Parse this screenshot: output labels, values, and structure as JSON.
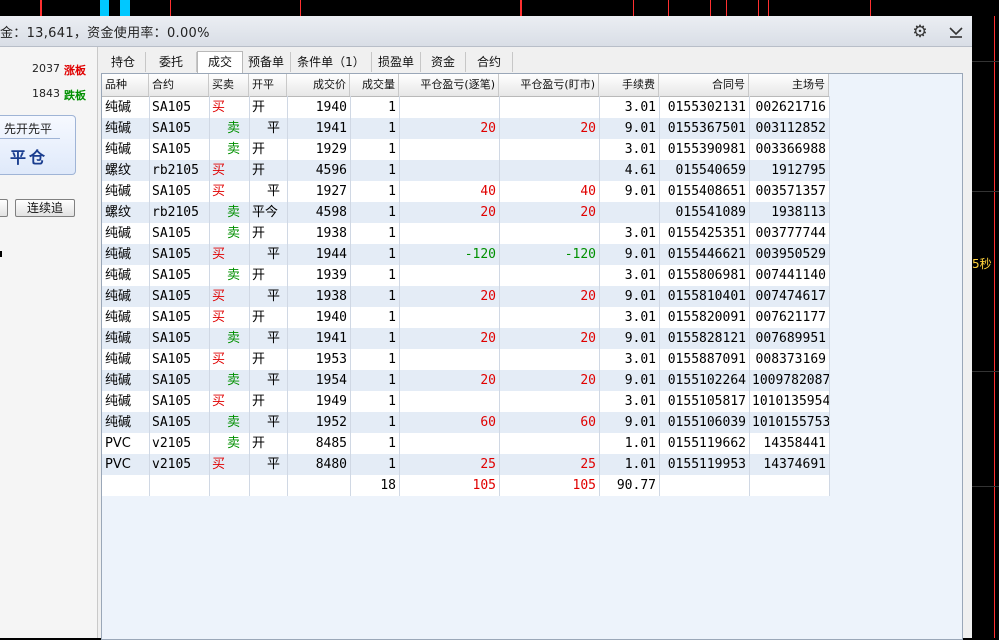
{
  "window": {
    "title_text": "金：13,641，资金使用率：0.00%"
  },
  "left_panel": {
    "limit_up": {
      "value": "2037",
      "label": "涨板"
    },
    "limit_down": {
      "value": "1843",
      "label": "跌板"
    },
    "open_close": {
      "mode_label": "先开先平",
      "action_label": "平仓"
    },
    "continuous_button": "连续追"
  },
  "tabs": [
    "持仓",
    "委托",
    "成交",
    "预备单",
    "条件单（1）",
    "损盈单",
    "资金",
    "合约"
  ],
  "active_tab": "成交",
  "columns": [
    "品种",
    "合约",
    "买卖",
    "开平",
    "成交价",
    "成交量",
    "平仓盈亏(逐笔)",
    "平仓盈亏(盯市)",
    "手续费",
    "合同号",
    "主场号"
  ],
  "rows": [
    [
      "纯碱",
      "SA105",
      "买",
      "开",
      "1940",
      "1",
      "",
      "",
      "3.01",
      "0155302131",
      "002621716"
    ],
    [
      "纯碱",
      "SA105",
      "卖",
      "平",
      "1941",
      "1",
      "20",
      "20",
      "9.01",
      "0155367501",
      "003112852"
    ],
    [
      "纯碱",
      "SA105",
      "卖",
      "开",
      "1929",
      "1",
      "",
      "",
      "3.01",
      "0155390981",
      "003366988"
    ],
    [
      "螺纹",
      "rb2105",
      "买",
      "开",
      "4596",
      "1",
      "",
      "",
      "4.61",
      "015540659",
      "1912795"
    ],
    [
      "纯碱",
      "SA105",
      "买",
      "平",
      "1927",
      "1",
      "40",
      "40",
      "9.01",
      "0155408651",
      "003571357"
    ],
    [
      "螺纹",
      "rb2105",
      "卖",
      "平今",
      "4598",
      "1",
      "20",
      "20",
      "",
      "015541089",
      "1938113"
    ],
    [
      "纯碱",
      "SA105",
      "卖",
      "开",
      "1938",
      "1",
      "",
      "",
      "3.01",
      "0155425351",
      "003777744"
    ],
    [
      "纯碱",
      "SA105",
      "买",
      "平",
      "1944",
      "1",
      "-120",
      "-120",
      "9.01",
      "0155446621",
      "003950529"
    ],
    [
      "纯碱",
      "SA105",
      "卖",
      "开",
      "1939",
      "1",
      "",
      "",
      "3.01",
      "0155806981",
      "007441140"
    ],
    [
      "纯碱",
      "SA105",
      "买",
      "平",
      "1938",
      "1",
      "20",
      "20",
      "9.01",
      "0155810401",
      "007474617"
    ],
    [
      "纯碱",
      "SA105",
      "买",
      "开",
      "1940",
      "1",
      "",
      "",
      "3.01",
      "0155820091",
      "007621177"
    ],
    [
      "纯碱",
      "SA105",
      "卖",
      "平",
      "1941",
      "1",
      "20",
      "20",
      "9.01",
      "0155828121",
      "007689951"
    ],
    [
      "纯碱",
      "SA105",
      "买",
      "开",
      "1953",
      "1",
      "",
      "",
      "3.01",
      "0155887091",
      "008373169"
    ],
    [
      "纯碱",
      "SA105",
      "卖",
      "平",
      "1954",
      "1",
      "20",
      "20",
      "9.01",
      "0155102264",
      "1009782087"
    ],
    [
      "纯碱",
      "SA105",
      "买",
      "开",
      "1949",
      "1",
      "",
      "",
      "3.01",
      "0155105817",
      "1010135954"
    ],
    [
      "纯碱",
      "SA105",
      "卖",
      "平",
      "1952",
      "1",
      "60",
      "60",
      "9.01",
      "0155106039",
      "1010155753"
    ],
    [
      "PVC",
      "v2105",
      "卖",
      "开",
      "8485",
      "1",
      "",
      "",
      "1.01",
      "0155119662",
      "14358441"
    ],
    [
      "PVC",
      "v2105",
      "买",
      "平",
      "8480",
      "1",
      "25",
      "25",
      "1.01",
      "0155119953",
      "14374691"
    ]
  ],
  "totals": {
    "volume": "18",
    "pnl_trade": "105",
    "pnl_mark": "105",
    "fee": "90.77"
  },
  "right_chart_label": "5秒",
  "colors": {
    "buy": "#e00000",
    "sell": "#009000",
    "profit": "#e00000",
    "loss": "#009000",
    "row_alt": "#e4ecf6"
  }
}
